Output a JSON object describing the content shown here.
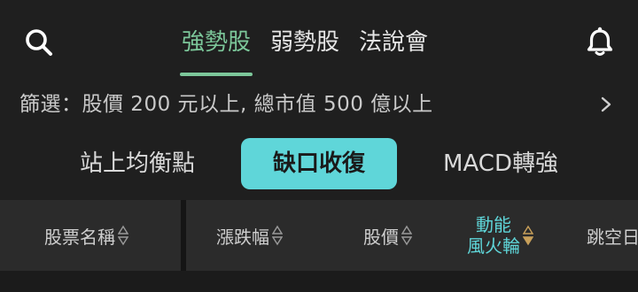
{
  "header": {
    "tabs": [
      {
        "label": "強勢股",
        "active": true
      },
      {
        "label": "弱勢股",
        "active": false
      },
      {
        "label": "法說會",
        "active": false
      }
    ],
    "search_icon": "search-icon",
    "bell_icon": "bell-icon"
  },
  "filter": {
    "text": "篩選：股價 200 元以上, 總市值 500 億以上",
    "chevron_icon": "chevron-right-icon"
  },
  "strategies": [
    {
      "label": "站上均衡點",
      "selected": false
    },
    {
      "label": "缺口收復",
      "selected": true
    },
    {
      "label": "MACD轉強",
      "selected": false
    }
  ],
  "table_header": {
    "columns": [
      {
        "label": "股票名稱",
        "sort": "none"
      },
      {
        "label": "漲跌幅",
        "sort": "none"
      },
      {
        "label": "股價",
        "sort": "none"
      },
      {
        "label_line1": "動能",
        "label_line2": "風火輪",
        "sort": "descending"
      },
      {
        "label": "跳空日",
        "sort": "none"
      }
    ]
  },
  "colors": {
    "background": "#1f1f1f",
    "accent_green": "#7cc79a",
    "accent_cyan": "#5fd6d9",
    "sort_active": "#c8a05a",
    "header_row": "#2b2b2b"
  }
}
